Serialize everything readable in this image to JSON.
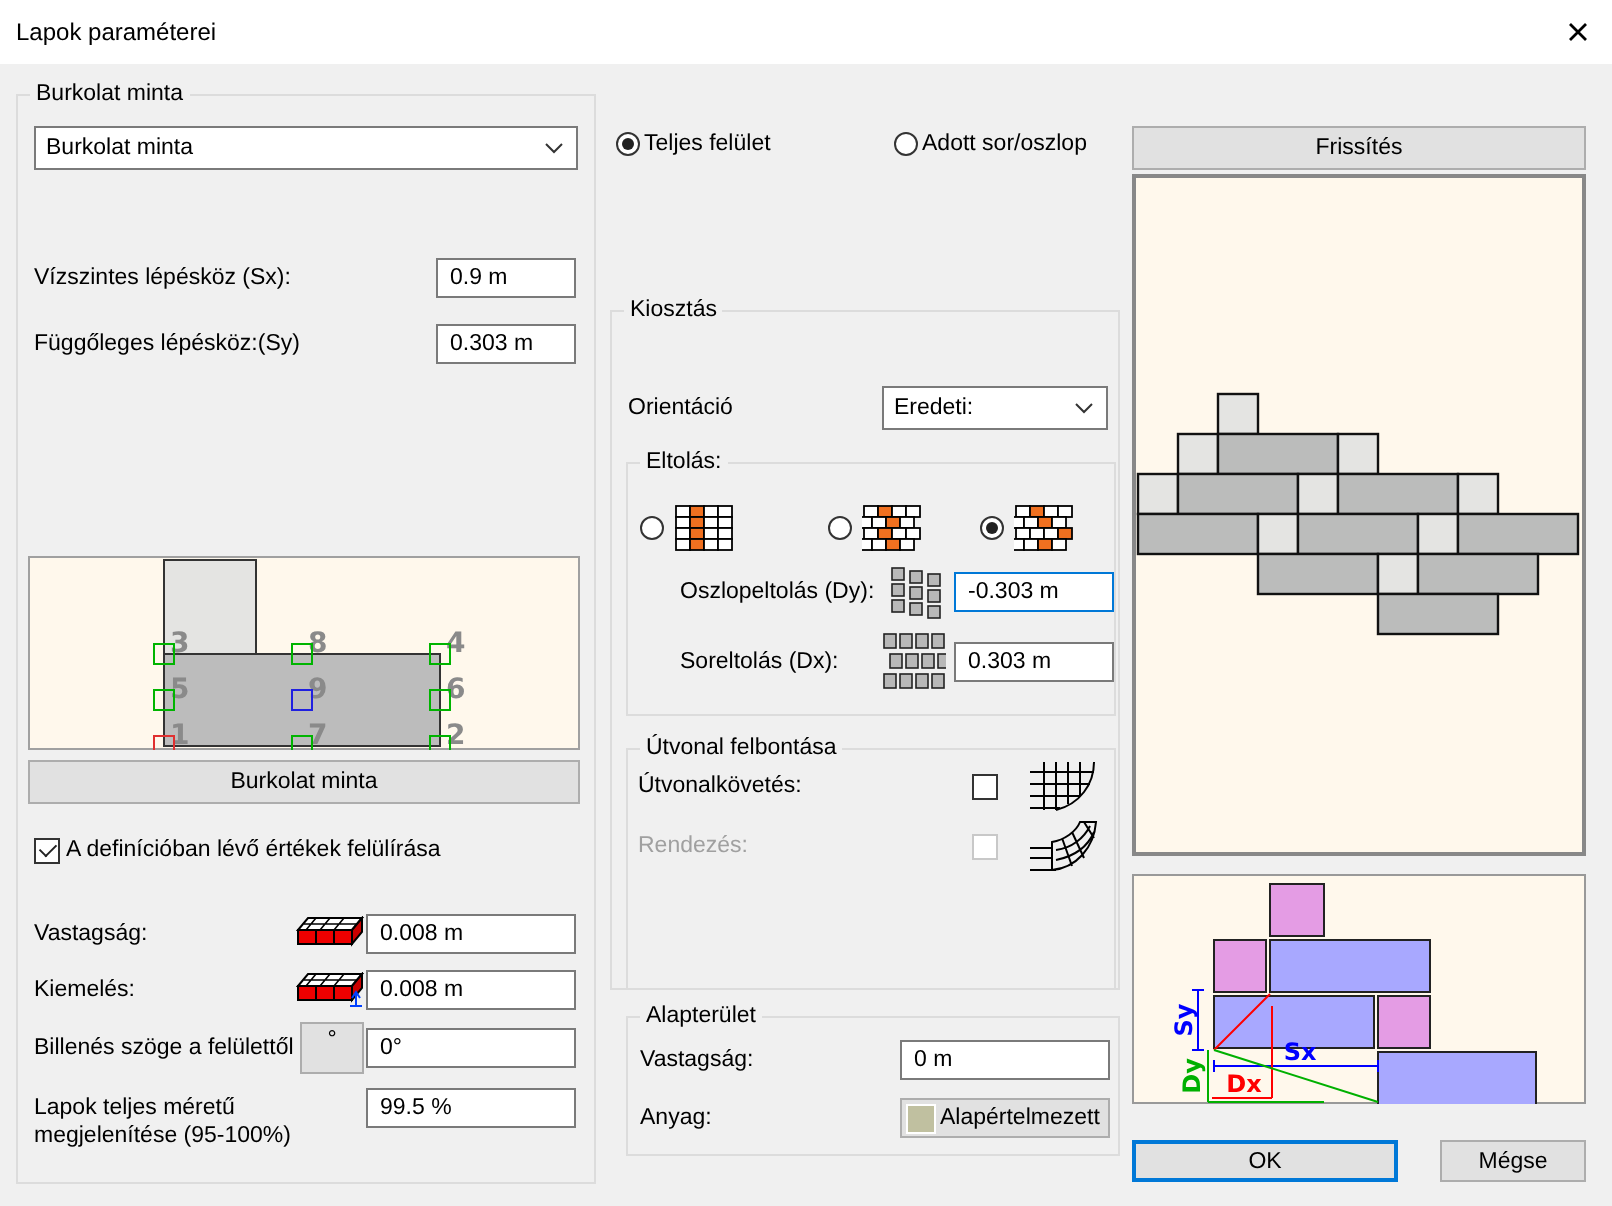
{
  "window": {
    "title": "Lapok paraméterei"
  },
  "pattern": {
    "title": "Burkolat minta",
    "dropdown": "Burkolat minta",
    "steps": [
      {
        "label": "Vízszintes lépésköz (Sx):",
        "value": "0.9 m"
      },
      {
        "label": "Függőleges lépésköz:(Sy)",
        "value": "0.303 m"
      }
    ],
    "anchors": [
      {
        "label": "3",
        "color": "#00b400"
      },
      {
        "label": "8",
        "color": "#00b400"
      },
      {
        "label": "4",
        "color": "#00b400"
      },
      {
        "label": "5",
        "color": "#00b400"
      },
      {
        "label": "9",
        "color": "#2020e0"
      },
      {
        "label": "6",
        "color": "#00b400"
      },
      {
        "label": "1",
        "color": "#e03030"
      },
      {
        "label": "7",
        "color": "#00b400"
      },
      {
        "label": "2",
        "color": "#00b400"
      }
    ],
    "button": "Burkolat minta",
    "override": {
      "label": "A definícióban lévő értékek felülírása",
      "checked": true
    },
    "properties": [
      {
        "kind": "thickness",
        "label": "Vastagság:",
        "value": "0.008 m"
      },
      {
        "kind": "elevation",
        "label": "Kiemelés:",
        "value": "0.008 m"
      },
      {
        "kind": "tilt",
        "label": "Billenés szöge a felülettől",
        "button": "°",
        "value": "0°"
      },
      {
        "kind": "plain",
        "label": "Lapok teljes méretű megjelenítése (95-100%)",
        "value": "99.5 %"
      }
    ]
  },
  "fill_mode": [
    {
      "label": "Teljes felület",
      "selected": true
    },
    {
      "label": "Adott sor/oszlop",
      "selected": false
    }
  ],
  "layout": {
    "title": "Kiosztás",
    "orientation": {
      "label": "Orientáció",
      "value": "Eredeti:"
    },
    "offset": {
      "title": "Eltolás:",
      "options": [
        {
          "kind": "stacked",
          "selected": false
        },
        {
          "kind": "running",
          "selected": false
        },
        {
          "kind": "diagonal",
          "selected": true
        }
      ],
      "fields": [
        {
          "kind": "column",
          "label": "Oszlopeltolás (Dy):",
          "value": "-0.303 m",
          "focused": true
        },
        {
          "kind": "row",
          "label": "Soreltolás (Dx):",
          "value": "0.303 m",
          "focused": false
        }
      ]
    },
    "path": {
      "title": "Útvonal felbontása",
      "options": [
        {
          "kind": "follow",
          "label": "Útvonalkövetés:",
          "checked": false,
          "disabled": false
        },
        {
          "kind": "arrange",
          "label": "Rendezés:",
          "checked": false,
          "disabled": true
        }
      ]
    }
  },
  "base": {
    "title": "Alapterület",
    "thickness": {
      "label": "Vastagság:",
      "value": "0 m"
    },
    "material": {
      "label": "Anyag:",
      "value": "Alapértelmezett"
    }
  },
  "refresh_button": "Frissítés",
  "diagram_labels": [
    {
      "label": "Sy",
      "color": "#0000ff"
    },
    {
      "label": "Sx",
      "color": "#0000ff"
    },
    {
      "label": "Dy",
      "color": "#00b000"
    },
    {
      "label": "Dx",
      "color": "#ff0000"
    }
  ],
  "buttons": [
    {
      "label": "OK",
      "default": true
    },
    {
      "label": "Mégse",
      "default": false
    }
  ]
}
